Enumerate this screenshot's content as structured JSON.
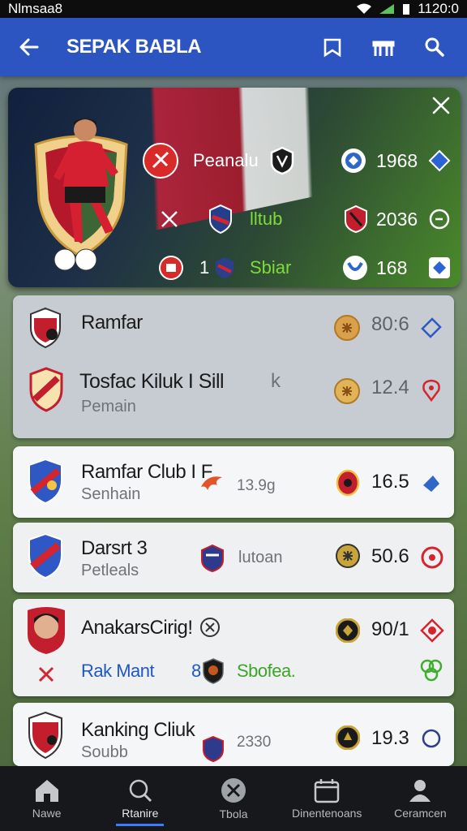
{
  "status_bar": {
    "left_text": "Nlmsaa8",
    "time": "1120:0"
  },
  "app_bar": {
    "title": "SEPAK BABLA"
  },
  "featured": {
    "rows": [
      {
        "label": "Peanalu",
        "value": "1968"
      },
      {
        "label": "lltub",
        "value": "2036"
      },
      {
        "prefix": "1",
        "label": "Sbiar",
        "value": "168"
      }
    ]
  },
  "list": [
    {
      "name": "Ramfar",
      "value": "80:6"
    },
    {
      "name": "Tosfac Kiluk I Sill",
      "extra": "k",
      "sub": "Pemain",
      "value": "12.4"
    },
    {
      "name": "Ramfar Club I F",
      "sub": "Senhain",
      "meta": "13.9g",
      "value": "16.5"
    },
    {
      "name": "Darsrt 3",
      "sub": "Petleals",
      "meta": "lutoan",
      "value": "50.6"
    },
    {
      "name": "AnakarsCirig!",
      "sub": "Rak Mant",
      "prefix": "8",
      "meta": "Sbofea.",
      "value": "90/1"
    },
    {
      "name": "Kanking Cliuk",
      "sub": "Soubb",
      "meta": "2330",
      "value": "19.3"
    }
  ],
  "bottom_nav": [
    {
      "label": "Nawe",
      "icon": "home-icon"
    },
    {
      "label": "Rtanire",
      "icon": "search-icon",
      "active": true
    },
    {
      "label": "Tbola",
      "icon": "ball-icon"
    },
    {
      "label": "Dinentenoans",
      "icon": "calendar-icon"
    },
    {
      "label": "Ceramcen",
      "icon": "person-icon"
    }
  ],
  "colors": {
    "app_bar": "#2d55c2",
    "accent": "#3b7bff",
    "nav_bg": "#16181b"
  }
}
